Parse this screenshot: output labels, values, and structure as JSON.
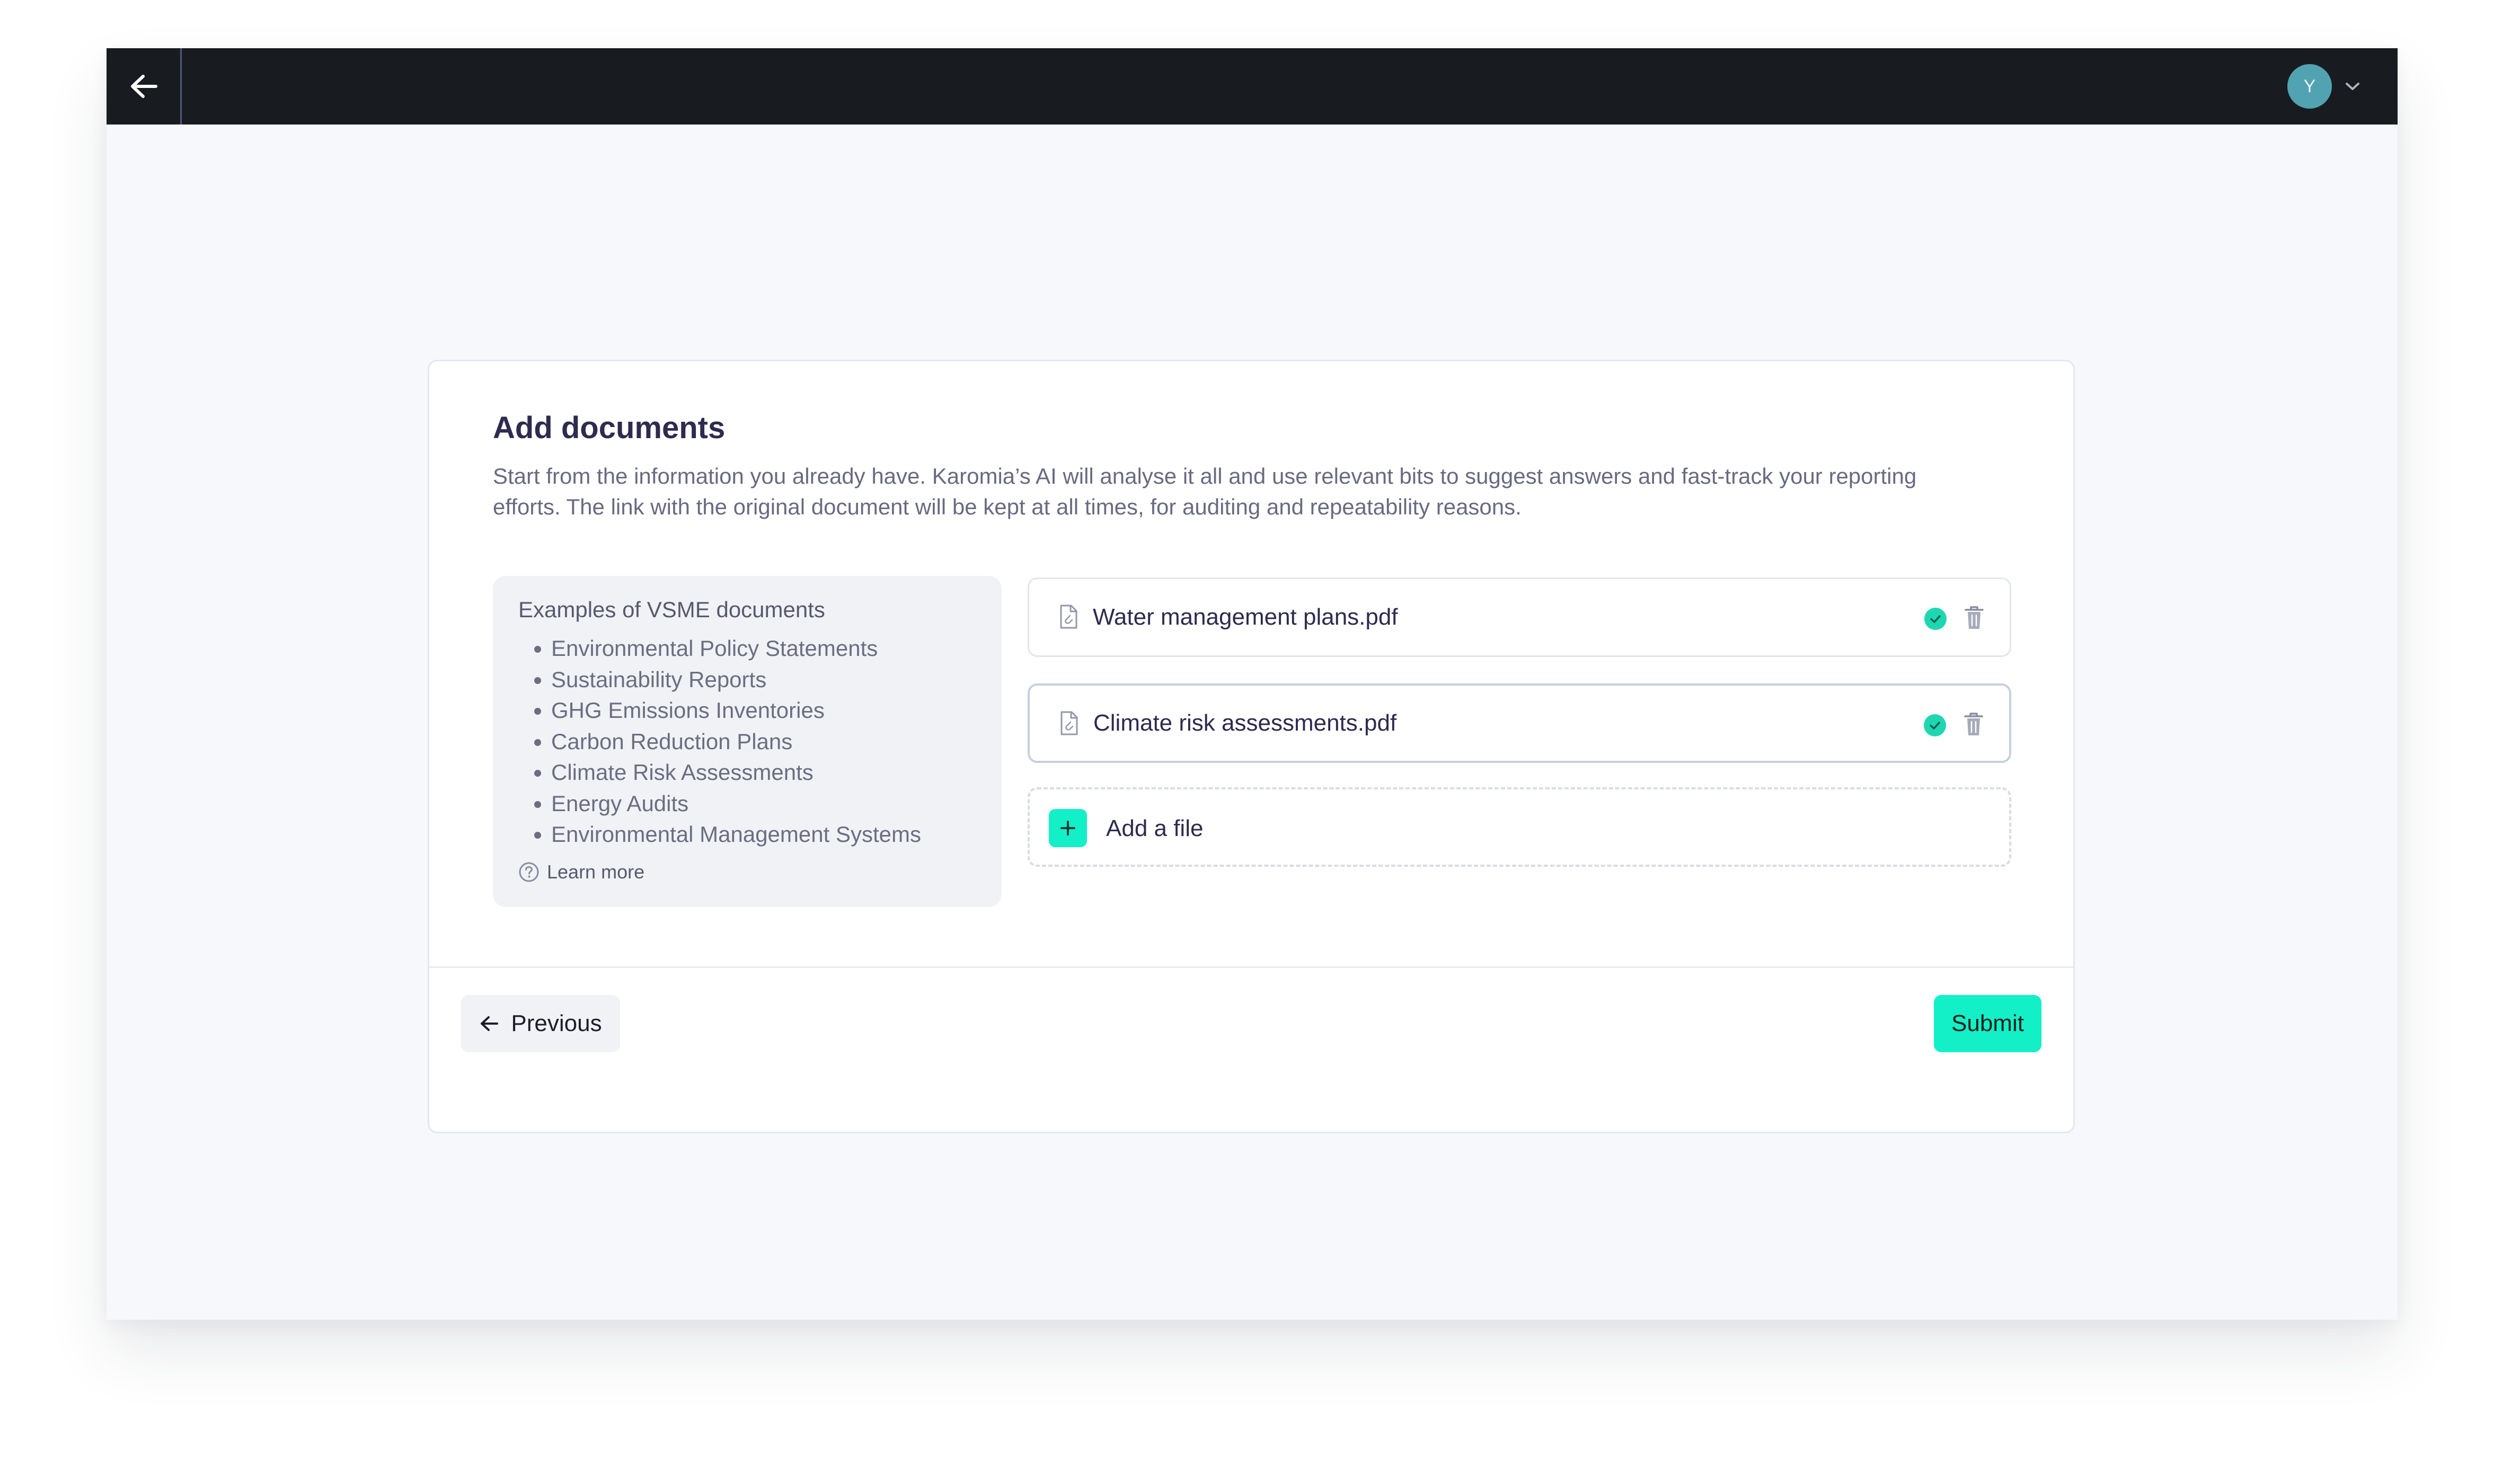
{
  "topbar": {
    "back_icon": "arrow-left-icon",
    "user_initial": "Y",
    "menu_icon": "chevron-down-icon",
    "background": "#181c20"
  },
  "card": {
    "title": "Add documents",
    "description": "Start from the information you already have. Karomia’s AI will analyse it all and use relevant bits to suggest answers and fast-track your reporting efforts. The link with the original document will be kept at all times, for auditing and repeatability reasons."
  },
  "examples": {
    "title": "Examples of VSME documents",
    "items": [
      "Environmental Policy Statements",
      "Sustainability Reports",
      "GHG Emissions Inventories",
      "Carbon Reduction Plans",
      "Climate Risk Assessments",
      "Energy Audits",
      "Environmental Management Systems"
    ],
    "learn_more": "Learn more"
  },
  "files": [
    {
      "name": "Water management plans.pdf",
      "status": "uploaded",
      "status_icon": "check-circle-icon",
      "delete_icon": "trash-icon"
    },
    {
      "name": "Climate risk assessments.pdf",
      "status": "uploaded",
      "status_icon": "check-circle-icon",
      "delete_icon": "trash-icon"
    }
  ],
  "add_file": {
    "label": "Add a file",
    "icon": "plus-icon"
  },
  "footer": {
    "previous_label": "Previous",
    "submit_label": "Submit"
  },
  "colors": {
    "accent": "#13f0c7",
    "check": "#1ed7b1",
    "heading": "#2d2b4e",
    "muted_text": "#686a80",
    "avatar": "#52a3b1"
  }
}
